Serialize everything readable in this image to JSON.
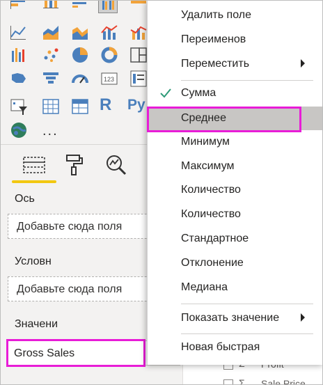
{
  "panel": {
    "more_label": "...",
    "r_icon": "R",
    "py_icon": "Py",
    "tabs": [
      {
        "icon": "fields-icon",
        "active": true
      },
      {
        "icon": "format-paint-icon",
        "active": false
      },
      {
        "icon": "analytics-icon",
        "active": false
      }
    ],
    "wells": [
      {
        "label": "Ось",
        "placeholder": "Добавьте сюда поля"
      },
      {
        "label": "Условн",
        "placeholder": "Добавьте сюда поля"
      },
      {
        "label": "Значени",
        "value": "Gross Sales"
      }
    ]
  },
  "background_fields": [
    "Profit",
    "Sale Price"
  ],
  "context_menu": {
    "items": [
      {
        "label": "Удалить поле"
      },
      {
        "label": "Переименов"
      },
      {
        "label": "Переместить",
        "submenu": true
      },
      {
        "label": "Сумма",
        "checked": true
      },
      {
        "label": "Среднее",
        "selected": true
      },
      {
        "label": "Минимум"
      },
      {
        "label": "Максимум"
      },
      {
        "label": "Количество"
      },
      {
        "label": "Количество"
      },
      {
        "label": "Стандартное"
      },
      {
        "label": "Отклонение"
      },
      {
        "label": "Медиана"
      },
      {
        "label": "Показать значение",
        "submenu": true
      },
      {
        "label": "Новая быстрая"
      }
    ]
  },
  "colors": {
    "highlight": "#e81cd7",
    "active_tab": "#f2c811",
    "check": "#2e9a78",
    "selected_bg": "#c8c6c4"
  }
}
